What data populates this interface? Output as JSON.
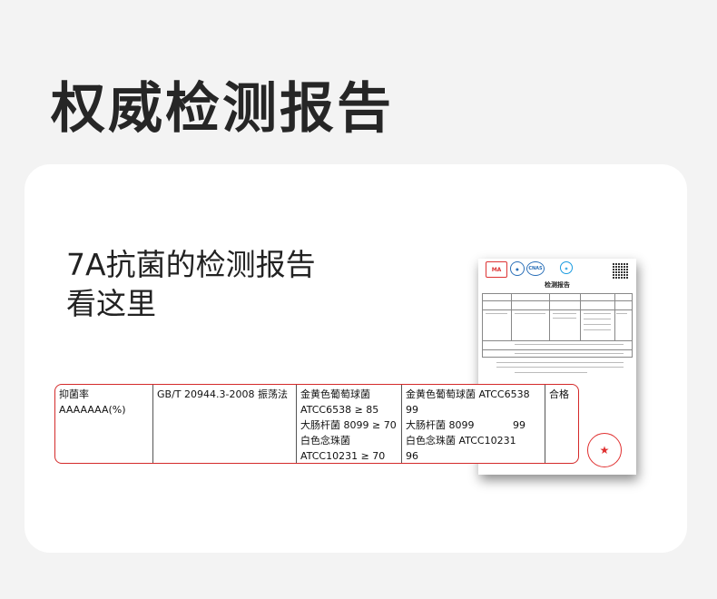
{
  "header": {
    "title": "权威检测报告"
  },
  "intro": {
    "line1": "7A抗菌的检测报告",
    "line2": "看这里"
  },
  "report": {
    "title": "检测报告",
    "logos": {
      "ma": "MA",
      "cnas": "CNAS"
    },
    "stamp_icon": "star-icon"
  },
  "table": {
    "col1": [
      "抑菌率",
      "AAAAAAA(%)"
    ],
    "col2": [
      "GB/T 20944.3-2008  振荡法"
    ],
    "col3": [
      "金黄色葡萄球菌",
      "ATCC6538 ≥ 85",
      "大肠杆菌 8099 ≥ 70",
      "白色念珠菌",
      "ATCC10231 ≥ 70"
    ],
    "col4": [
      "金黄色葡萄球菌 ATCC6538",
      "99",
      "大肠杆菌 8099",
      "白色念珠菌 ATCC10231",
      "96"
    ],
    "col4_value2": "99",
    "col5": [
      "合格"
    ]
  },
  "colors": {
    "accent_red": "#d42a2a",
    "background": "#f3f3f3",
    "card": "#ffffff"
  }
}
